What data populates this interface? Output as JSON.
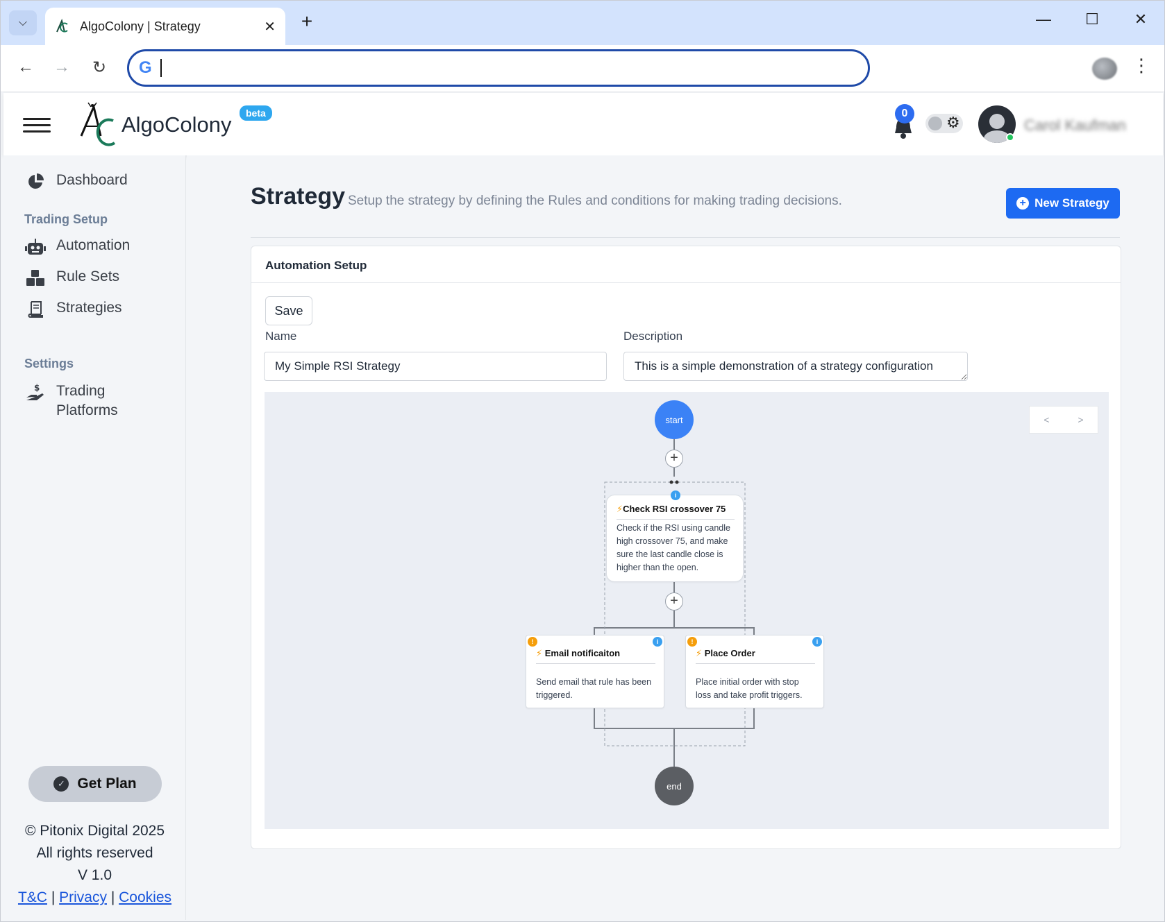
{
  "browser": {
    "tab_title": "AlgoColony | Strategy",
    "tab_close": "✕",
    "new_tab": "+",
    "omnibox_value": "",
    "google_glyph": "G"
  },
  "header": {
    "brand": "AlgoColony",
    "beta_label": "beta",
    "notification_count": "0",
    "user_name": "Carol Kaufman"
  },
  "sidebar": {
    "items": [
      {
        "label": "Dashboard",
        "icon": "pie-chart-icon"
      },
      {
        "label": "Automation",
        "icon": "robot-icon"
      },
      {
        "label": "Rule Sets",
        "icon": "cubes-icon"
      },
      {
        "label": "Strategies",
        "icon": "scroll-icon"
      },
      {
        "label": "Trading Platforms",
        "icon": "hand-dollar-icon"
      }
    ],
    "headings": {
      "trading_setup": "Trading Setup",
      "settings": "Settings"
    },
    "get_plan": "Get Plan",
    "footer": {
      "copyright": "© Pitonix Digital 2025",
      "rights": "All rights reserved",
      "version": "V 1.0",
      "tc": "T&C",
      "privacy": "Privacy",
      "cookies": "Cookies",
      "sep": "|"
    }
  },
  "main": {
    "title": "Strategy",
    "subtitle": "Setup the strategy by defining the Rules and conditions for making trading decisions.",
    "new_strategy": "New Strategy",
    "card": {
      "title": "Automation Setup",
      "save_label": "Save",
      "name_label": "Name",
      "name_value": "My Simple RSI Strategy",
      "description_label": "Description",
      "description_value": "This is a simple demonstration of a strategy configuration"
    },
    "flow": {
      "pager_prev": "<",
      "pager_next": ">",
      "start_label": "start",
      "end_label": "end",
      "add_symbol": "+",
      "info_symbol": "i",
      "warn_symbol": "!",
      "condition": {
        "title": "Check RSI crossover 75",
        "description": "Check if the RSI using candle high crossover 75, and make sure the last candle close is higher than the open."
      },
      "actions": [
        {
          "title": "Email notificaiton",
          "description": "Send email that rule has been triggered."
        },
        {
          "title": "Place Order",
          "description": "Place initial order with stop loss and take profit triggers."
        }
      ]
    }
  },
  "colors": {
    "primary": "#1d6af2",
    "start_node": "#3b82f6",
    "end_node": "#5b5e63",
    "beta": "#2ea7ef",
    "online": "#22c55e"
  }
}
